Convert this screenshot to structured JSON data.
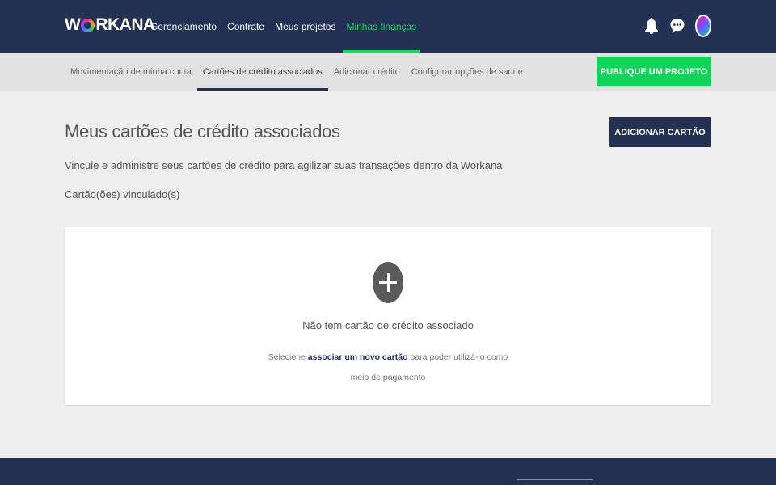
{
  "brand": {
    "logo_prefix": "W",
    "logo_suffix": "RKANA"
  },
  "main_nav": [
    {
      "label": "Gerenciamento"
    },
    {
      "label": "Contrate"
    },
    {
      "label": "Meus projetos"
    },
    {
      "label": "Minhas finanças",
      "active": true
    }
  ],
  "sub_nav": [
    {
      "label": "Movimentação de minha conta"
    },
    {
      "label": "Cartões de crédito associados",
      "active": true
    },
    {
      "label": "Adicionar crédito"
    },
    {
      "label": "Configurar opções de saque"
    }
  ],
  "publish_button": "PUBLIQUE UM PROJETO",
  "page": {
    "title": "Meus cartões de crédito associados",
    "add_card_button": "ADICIONAR CARTÃO",
    "subtitle": "Vincule e administre seus cartões de crédito para agilizar suas transações dentro da Workana",
    "linked_label": "Cartão(ões) vinculado(s)"
  },
  "empty_state": {
    "title": "Não tem cartão de crédito associado",
    "desc_before": "Selecione ",
    "desc_link": "associar um novo cartão",
    "desc_after": " para poder utilizá-lo como meio de pagamento"
  },
  "icons": {
    "notifications": "bell-icon",
    "messages": "chat-icon",
    "add": "plus-icon"
  },
  "colors": {
    "navbar": "#233154",
    "accent_green": "#12d45a",
    "active_tab_green": "#1ed760"
  }
}
